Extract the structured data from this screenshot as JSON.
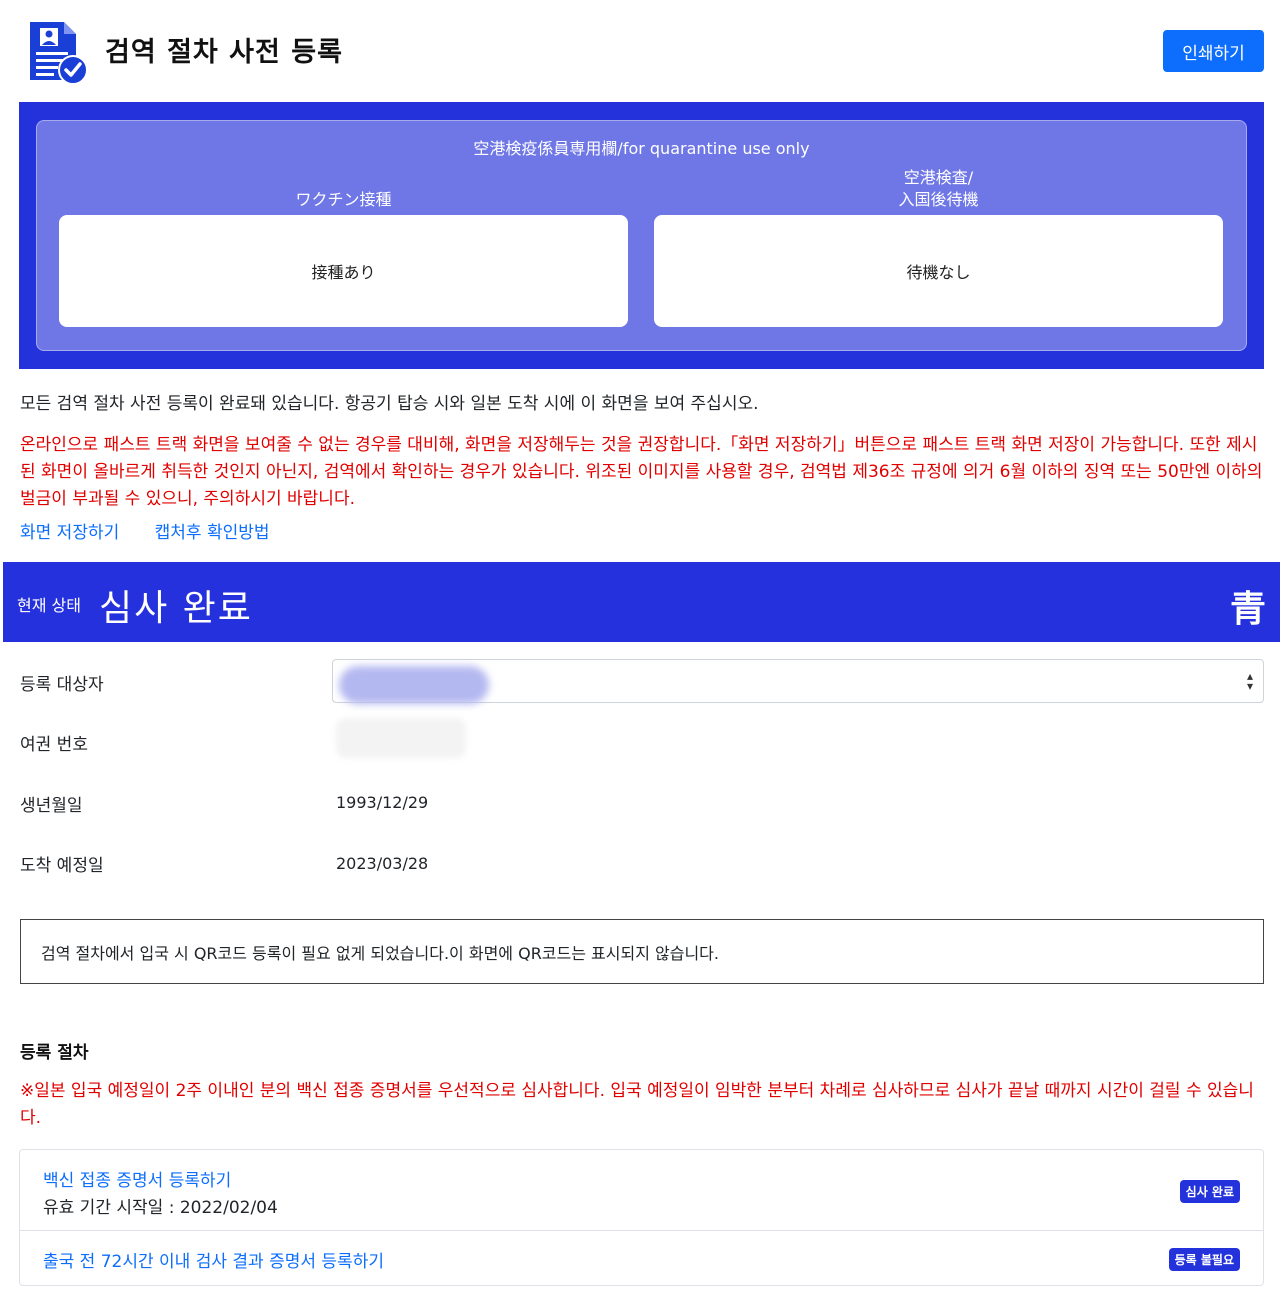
{
  "header": {
    "title": "검역 절차 사전 등록",
    "print_label": "인쇄하기",
    "logo_icon": "document-person-check-icon"
  },
  "quarantine": {
    "title": "空港検疫係員専用欄/for quarantine use only",
    "left_label": "ワクチン接種",
    "left_value": "接種あり",
    "right_label_line1": "空港検査/",
    "right_label_line2": "入国後待機",
    "right_value": "待機なし"
  },
  "notice": "모든 검역 절차 사전 등록이 완료돼 있습니다. 항공기 탑승 시와 일본 도착 시에 이 화면을 보여 주십시오.",
  "warning": "온라인으로 패스트 트랙 화면을 보여줄 수 없는 경우를 대비해, 화면을 저장해두는 것을 권장합니다.「화면 저장하기」버튼으로 패스트 트랙 화면 저장이 가능합니다. 또한 제시된 화면이 올바르게 취득한 것인지 아닌지, 검역에서 확인하는 경우가 있습니다. 위조된 이미지를 사용할 경우, 검역법 제36조 규정에 의거 6월 이하의 징역 또는 50만엔 이하의 벌금이 부과될 수 있으니, 주의하시기 바랍니다.",
  "links": {
    "save_screen": "화면 저장하기",
    "capture_help": "캡처후 확인방법"
  },
  "status": {
    "label": "현재 상태",
    "value": "심사 완료",
    "kanji": "青",
    "color": "#2431dc"
  },
  "fields": {
    "registrant_label": "등록 대상자",
    "passport_label": "여권 번호",
    "birth_label": "생년월일",
    "birth_value": "1993/12/29",
    "arrival_label": "도착 예정일",
    "arrival_value": "2023/03/28"
  },
  "info_box": "검역 절차에서 입국 시 QR코드 등록이 필요 없게 되었습니다.이 화면에 QR코드는 표시되지 않습니다.",
  "procedure": {
    "title": "등록 절차",
    "warning": "※일본 입국 예정일이 2주 이내인 분의 백신 접종 증명서를 우선적으로 심사합니다. 입국 예정일이 임박한 분부터 차례로 심사하므로 심사가 끝날 때까지 시간이 걸릴 수 있습니다.",
    "items": [
      {
        "link": "백신 접종 증명서 등록하기",
        "sub": "유효 기간 시작일 : 2022/02/04",
        "badge": "심사 완료"
      },
      {
        "link": "출국 전 72시간 이내 검사 결과 증명서 등록하기",
        "badge": "등록 불필요"
      }
    ]
  }
}
